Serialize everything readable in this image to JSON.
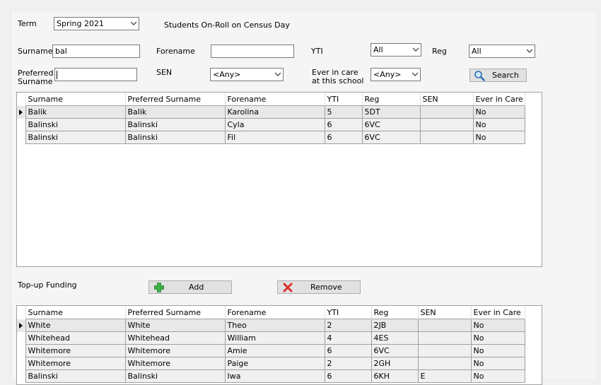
{
  "filters": {
    "term_label": "Term",
    "term_value": "Spring 2021",
    "census_title": "Students On-Roll on Census Day",
    "surname_label": "Surname",
    "surname_value": "bal",
    "forename_label": "Forename",
    "forename_value": "",
    "yti_label": "YTI",
    "yti_value": "All",
    "reg_label": "Reg",
    "reg_value": "All",
    "preferred_surname_label_1": "Preferred",
    "preferred_surname_label_2": "Surname",
    "preferred_surname_value": "",
    "sen_label": "SEN",
    "sen_value": "<Any>",
    "ever_in_care_label_1": "Ever in care",
    "ever_in_care_label_2": "at this school",
    "ever_in_care_value": "<Any>",
    "search_label": "Search"
  },
  "grid_columns": [
    "Surname",
    "Preferred Surname",
    "Forename",
    "YTI",
    "Reg",
    "SEN",
    "Ever in Care"
  ],
  "search_results": [
    [
      "Balik",
      "Balik",
      "Karolina",
      "5",
      "5DT",
      "",
      "No"
    ],
    [
      "Balinski",
      "Balinski",
      "Cyla",
      "6",
      "6VC",
      "",
      "No"
    ],
    [
      "Balinski",
      "Balinski",
      "Fil",
      "6",
      "6VC",
      "",
      "No"
    ]
  ],
  "topup": {
    "label": "Top-up Funding",
    "add_label": "Add",
    "remove_label": "Remove"
  },
  "topup_rows": [
    [
      "White",
      "White",
      "Theo",
      "2",
      "2JB",
      "",
      "No"
    ],
    [
      "Whitehead",
      "Whitehead",
      "William",
      "4",
      "4ES",
      "",
      "No"
    ],
    [
      "Whitemore",
      "Whitemore",
      "Amie",
      "6",
      "6VC",
      "",
      "No"
    ],
    [
      "Whitemore",
      "Whitemore",
      "Paige",
      "2",
      "2GH",
      "",
      "No"
    ],
    [
      "Balinski",
      "Balinski",
      "Iwa",
      "6",
      "6KH",
      "E",
      "No"
    ]
  ],
  "colors": {
    "add_icon": "#3cb043",
    "remove_icon": "#d9302c",
    "search_icon": "#2a6fb0"
  }
}
